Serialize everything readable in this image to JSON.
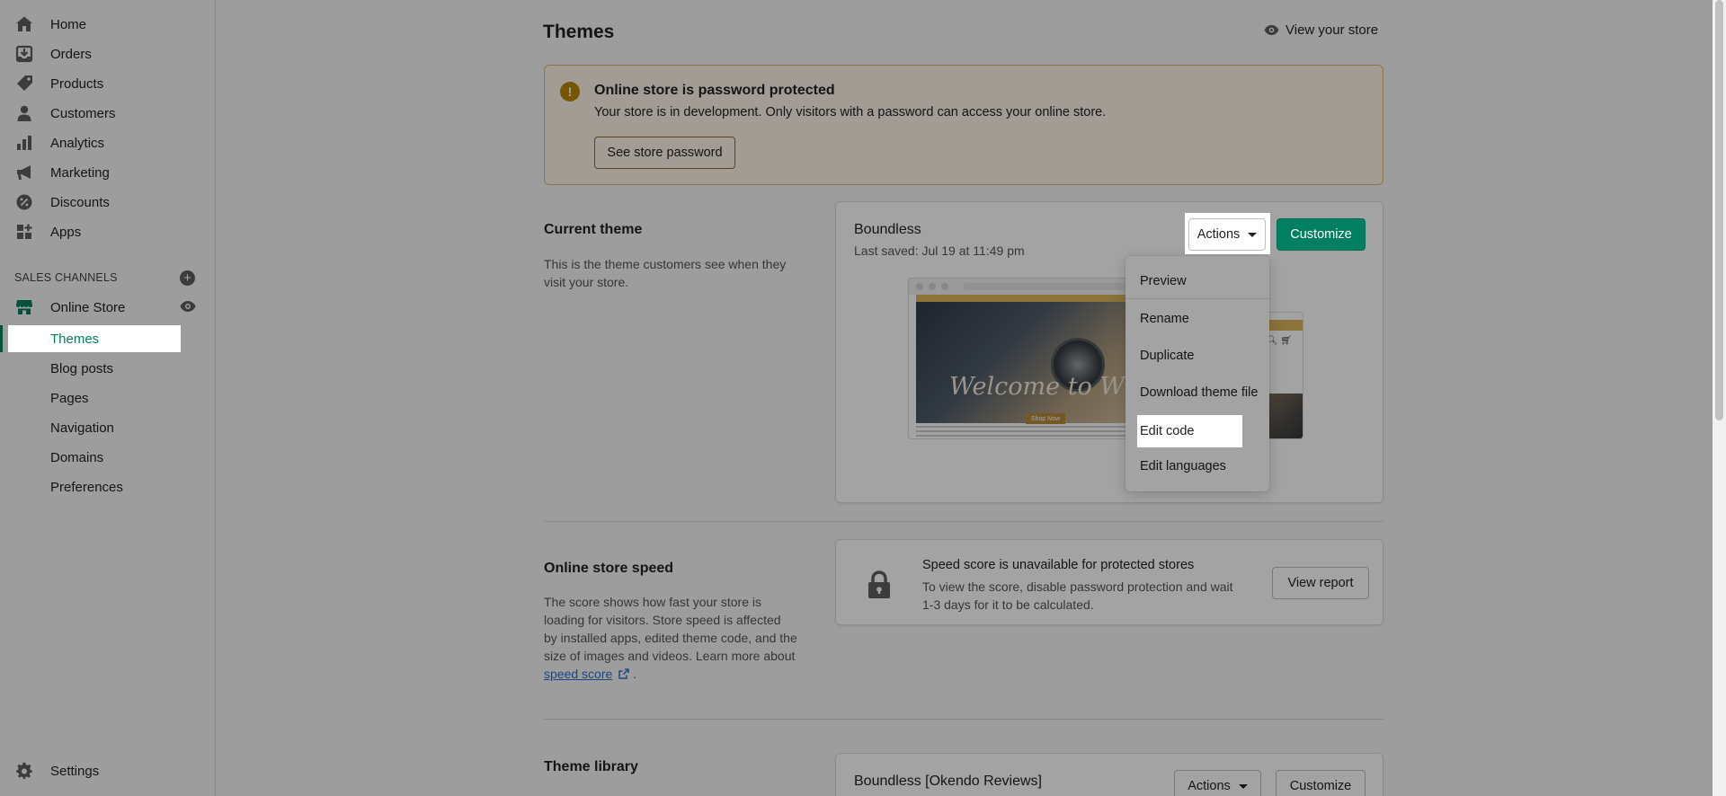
{
  "sidebar": {
    "items": [
      {
        "label": "Home",
        "icon": "home-icon"
      },
      {
        "label": "Orders",
        "icon": "orders-icon"
      },
      {
        "label": "Products",
        "icon": "tag-icon"
      },
      {
        "label": "Customers",
        "icon": "person-icon"
      },
      {
        "label": "Analytics",
        "icon": "bar-chart-icon"
      },
      {
        "label": "Marketing",
        "icon": "megaphone-icon"
      },
      {
        "label": "Discounts",
        "icon": "discount-icon"
      },
      {
        "label": "Apps",
        "icon": "apps-icon"
      }
    ],
    "sales_channels_label": "SALES CHANNELS",
    "online_store_label": "Online Store",
    "subitems": [
      "Themes",
      "Blog posts",
      "Pages",
      "Navigation",
      "Domains",
      "Preferences"
    ],
    "settings_label": "Settings"
  },
  "header": {
    "title": "Themes",
    "view_store": "View your store"
  },
  "banner": {
    "title": "Online store is password protected",
    "text": "Your store is in development. Only visitors with a password can access your online store.",
    "button": "See store password"
  },
  "current_theme": {
    "section_title": "Current theme",
    "section_desc": "This is the theme customers see when they visit your store.",
    "name": "Boundless",
    "last_saved": "Last saved: Jul 19 at 11:49 pm",
    "actions_label": "Actions",
    "customize_label": "Customize",
    "preview_welcome": "Welcome to Wristlin",
    "preview_shop": "Shop Now"
  },
  "actions_menu": {
    "items": [
      "Preview",
      "Rename",
      "Duplicate",
      "Download theme file",
      "Edit code",
      "Edit languages"
    ]
  },
  "speed": {
    "section_title": "Online store speed",
    "section_desc_1": "The score shows how fast your store is loading for visitors. Store speed is affected by installed apps, edited theme code, and the size of images and videos. Learn more about",
    "link": "speed score",
    "period": ".",
    "card_title": "Speed score is unavailable for protected stores",
    "card_text": "To view the score, disable password protection and wait 1-3 days for it to be calculated.",
    "button": "View report"
  },
  "library": {
    "section_title": "Theme library",
    "theme_name": "Boundless [Okendo Reviews]",
    "actions_label": "Actions",
    "customize_label": "Customize"
  }
}
